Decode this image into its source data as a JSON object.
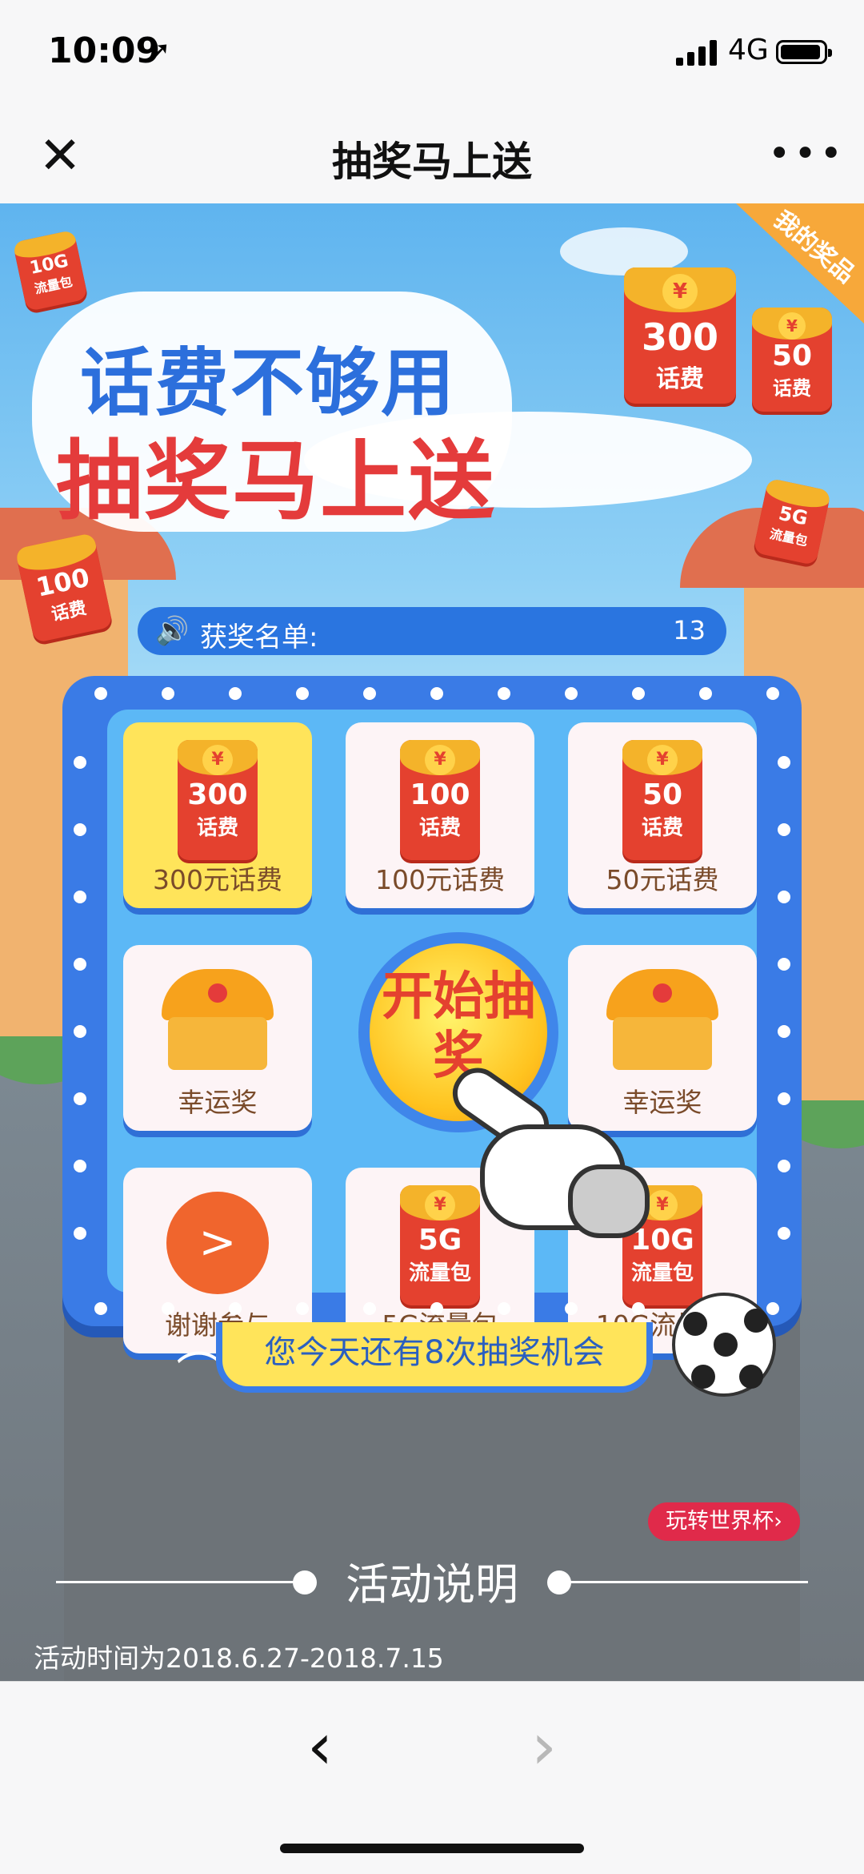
{
  "status_bar": {
    "time": "10:09",
    "location_arrow": "➚",
    "network": "4G"
  },
  "nav": {
    "close": "✕",
    "title": "抽奖马上送",
    "more": "•••"
  },
  "banner": {
    "headline_1": "话费不够用",
    "headline_2": "抽奖马上送",
    "my_prizes": "我的奖品",
    "envelopes": [
      {
        "amount": "300",
        "unit": "话费"
      },
      {
        "amount": "50",
        "unit": "话费"
      },
      {
        "amount": "100",
        "unit": "话费"
      },
      {
        "amount": "10G",
        "unit": "流量包"
      },
      {
        "amount": "5G",
        "unit": "流量包"
      }
    ]
  },
  "winners": {
    "label": "获奖名单:",
    "count": "13",
    "icon": "speaker-icon"
  },
  "board": {
    "tiles": [
      {
        "label": "300元话费",
        "amount": "300",
        "unit": "话费",
        "kind": "envelope",
        "active": true
      },
      {
        "label": "100元话费",
        "amount": "100",
        "unit": "话费",
        "kind": "envelope"
      },
      {
        "label": "50元话费",
        "amount": "50",
        "unit": "话费",
        "kind": "envelope"
      },
      {
        "label": "幸运奖",
        "kind": "chest"
      },
      {
        "label": "幸运奖",
        "kind": "chest"
      },
      {
        "label": "谢谢参与",
        "kind": "sad-face"
      },
      {
        "label": "5G流量包",
        "amount": "5G",
        "unit": "流量包",
        "kind": "envelope"
      },
      {
        "label": "10G流量包",
        "amount": "10G",
        "unit": "流量包",
        "kind": "envelope"
      }
    ],
    "start_button": "开始抽奖"
  },
  "chances": "您今天还有8次抽奖机会",
  "world_cup": "玩转世界杯›",
  "rules": {
    "title": "活动说明",
    "period": "活动时间为2018.6.27-2018.7.15"
  },
  "toolbar": {
    "back": "‹",
    "forward": "›"
  },
  "colors": {
    "board_blue": "#3a7be6",
    "active_yellow": "#ffe45a",
    "envelope_red": "#e4412f"
  }
}
